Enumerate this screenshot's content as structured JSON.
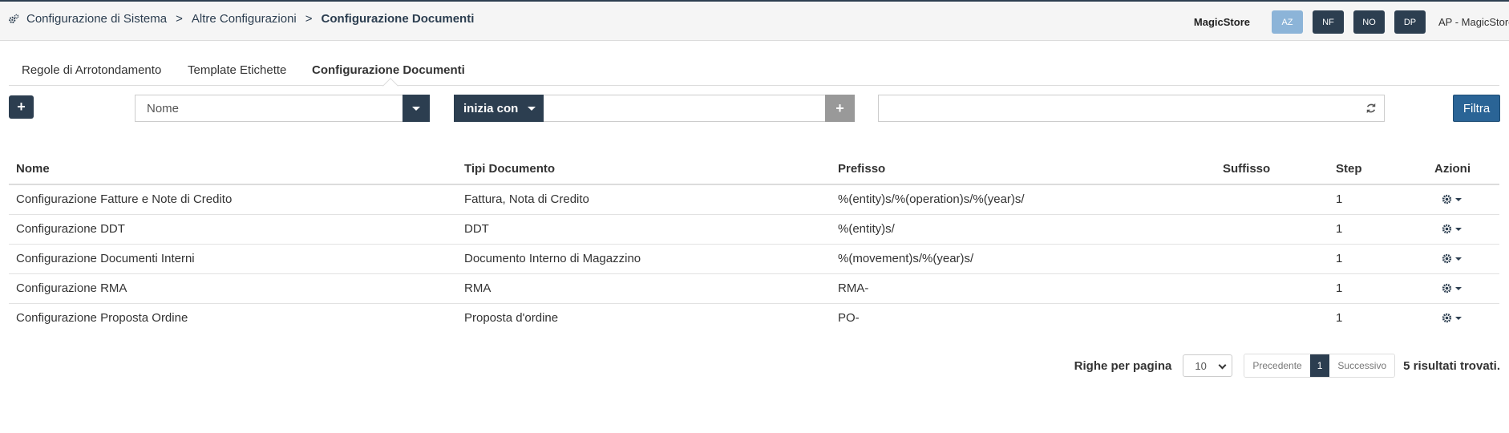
{
  "breadcrumb": {
    "items": [
      "Configurazione di Sistema",
      "Altre Configurazioni",
      "Configurazione Documenti"
    ],
    "separator": ">"
  },
  "header": {
    "store": "MagicStore",
    "buttons": [
      "AZ",
      "NF",
      "NO",
      "DP"
    ],
    "user": "AP - MagicStore"
  },
  "tabs": [
    {
      "label": "Regole di Arrotondamento",
      "active": false
    },
    {
      "label": "Template Etichette",
      "active": false
    },
    {
      "label": "Configurazione Documenti",
      "active": true
    }
  ],
  "filter": {
    "add_label": "+",
    "field_value": "Nome",
    "operator_label": "inizia con",
    "value_input": "",
    "plus_label": "+",
    "date_value": "",
    "filter_label": "Filtra"
  },
  "table": {
    "headers": [
      "Nome",
      "Tipi Documento",
      "Prefisso",
      "Suffisso",
      "Step",
      "Azioni"
    ],
    "rows": [
      {
        "nome": "Configurazione Fatture e Note di Credito",
        "tipi": "Fattura, Nota di Credito",
        "prefisso": "%(entity)s/%(operation)s/%(year)s/",
        "suffisso": "",
        "step": "1"
      },
      {
        "nome": "Configurazione DDT",
        "tipi": "DDT",
        "prefisso": "%(entity)s/",
        "suffisso": "",
        "step": "1"
      },
      {
        "nome": "Configurazione Documenti Interni",
        "tipi": "Documento Interno di Magazzino",
        "prefisso": "%(movement)s/%(year)s/",
        "suffisso": "",
        "step": "1"
      },
      {
        "nome": "Configurazione RMA",
        "tipi": "RMA",
        "prefisso": "RMA-",
        "suffisso": "",
        "step": "1"
      },
      {
        "nome": "Configurazione Proposta Ordine",
        "tipi": "Proposta d'ordine",
        "prefisso": "PO-",
        "suffisso": "",
        "step": "1"
      }
    ]
  },
  "pagination": {
    "rows_label": "Righe per pagina",
    "rows_value": "10",
    "prev": "Precedente",
    "page": "1",
    "next": "Successivo",
    "results": "5 risultati trovati."
  },
  "icons": {
    "breadcrumb": "cogs-icon",
    "action": "gear-icon",
    "refresh": "refresh-icon"
  },
  "colors": {
    "primary": "#2c3e50",
    "filter": "#2a6496",
    "light_button": "#8cb4d8",
    "disabled_button": "#999999"
  }
}
